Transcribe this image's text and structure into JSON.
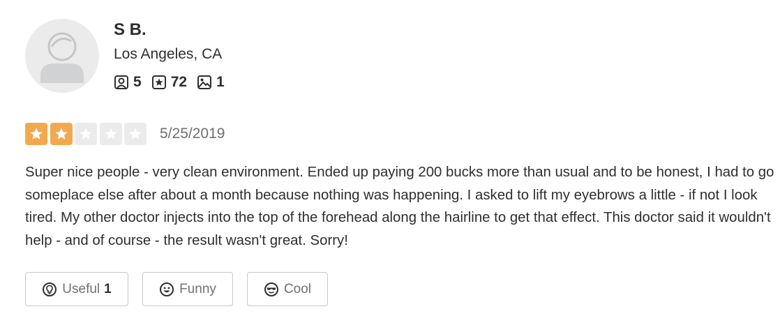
{
  "user": {
    "name": "S B.",
    "location": "Los Angeles, CA",
    "friends": "5",
    "reviews": "72",
    "photos": "1"
  },
  "review": {
    "rating": 2,
    "max_rating": 5,
    "date": "5/25/2019",
    "text": "Super nice people - very clean environment. Ended up paying 200 bucks more than usual and to be honest, I had to go someplace else after about a month because nothing was happening. I asked to lift my eyebrows a little - if not I look tired. My other doctor injects into the top of the forehead along the hairline to get that effect. This doctor said it wouldn't help - and of course - the result wasn't great. Sorry!"
  },
  "actions": {
    "useful_label": "Useful",
    "useful_count": "1",
    "funny_label": "Funny",
    "cool_label": "Cool"
  },
  "colors": {
    "star_filled": "#f2a94e",
    "star_empty": "#ebebeb",
    "text": "#2d2e2f",
    "muted": "#6e7072"
  },
  "icons": {
    "avatar": "default-user-avatar-icon",
    "friends": "friends-icon",
    "reviews": "review-star-icon",
    "photos": "photo-icon",
    "useful": "lightbulb-icon",
    "funny": "smile-icon",
    "cool": "sunglasses-icon"
  }
}
